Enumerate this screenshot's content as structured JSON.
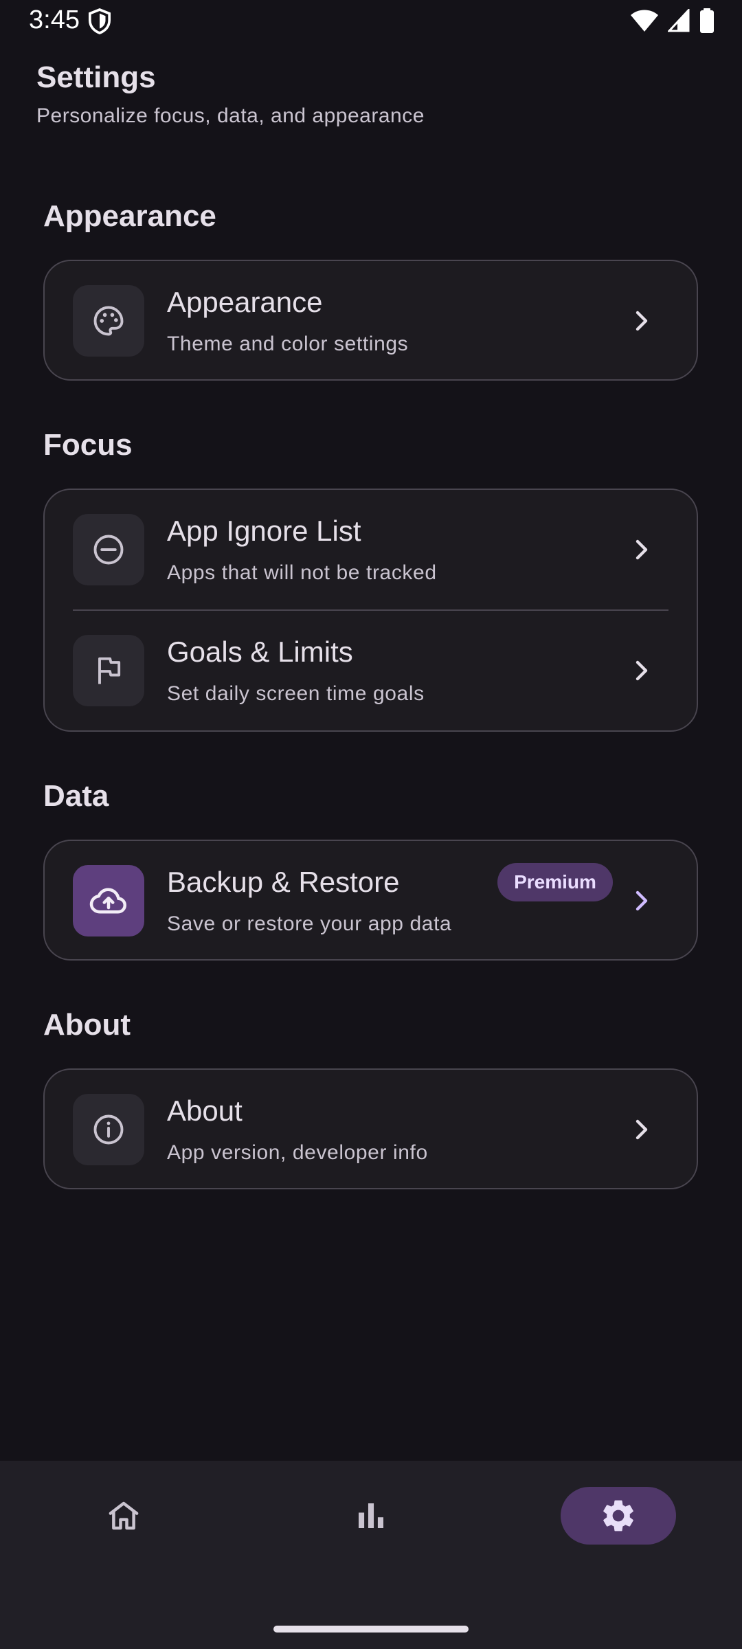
{
  "status_bar": {
    "time": "3:45",
    "icons": [
      "shield-icon",
      "wifi-icon",
      "cellular-icon",
      "battery-icon"
    ]
  },
  "header": {
    "title": "Settings",
    "subtitle": "Personalize focus, data, and appearance"
  },
  "sections": {
    "appearance": {
      "title": "Appearance",
      "items": [
        {
          "icon": "palette-icon",
          "title": "Appearance",
          "subtitle": "Theme and color settings"
        }
      ]
    },
    "focus": {
      "title": "Focus",
      "items": [
        {
          "icon": "minus-circle-icon",
          "title": "App Ignore List",
          "subtitle": "Apps that will not be tracked"
        },
        {
          "icon": "flag-icon",
          "title": "Goals & Limits",
          "subtitle": "Set daily screen time goals"
        }
      ]
    },
    "data": {
      "title": "Data",
      "items": [
        {
          "icon": "cloud-upload-icon",
          "title": "Backup & Restore",
          "subtitle": "Save or restore your app data",
          "badge": "Premium"
        }
      ]
    },
    "about": {
      "title": "About",
      "items": [
        {
          "icon": "info-icon",
          "title": "About",
          "subtitle": "App version, developer info"
        }
      ]
    }
  },
  "bottom_nav": {
    "items": [
      {
        "icon": "home-icon",
        "active": false
      },
      {
        "icon": "bar-chart-icon",
        "active": false
      },
      {
        "icon": "gear-icon",
        "active": true
      }
    ]
  },
  "colors": {
    "background": "#141218",
    "card": "#1D1B20",
    "card_border": "#49454F",
    "accent": "#4F3768",
    "accent_text": "#EADDFF"
  }
}
